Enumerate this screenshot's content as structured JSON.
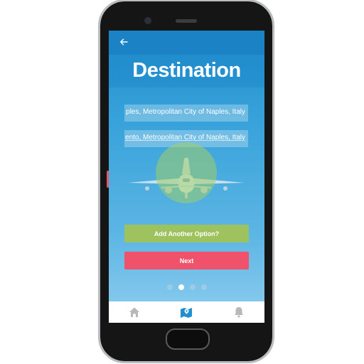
{
  "header": {
    "title": "Destination",
    "back_icon": "arrow-left-icon"
  },
  "destinations": [
    {
      "value": "Naples, Metropolitan City of Naples, Italy",
      "visible_text": "ples, Metropolitan City of Naples, Italy"
    },
    {
      "value": "Sorrento, Metropolitan City of Naples, Italy",
      "visible_text": "ento, Metropolitan City of Naples, Italy"
    }
  ],
  "buttons": {
    "add_option": "Add Another Option?",
    "next": "Next"
  },
  "pager": {
    "total": 4,
    "active": 1
  },
  "bottom_nav": [
    {
      "icon": "home-icon",
      "active": false
    },
    {
      "icon": "map-icon",
      "active": true
    },
    {
      "icon": "bell-icon",
      "active": false
    }
  ],
  "colors": {
    "accent_blue": "#1b82c6",
    "add_button": "#9ec25d",
    "next_button": "#f0526b",
    "nav_active": "#1f8fcf",
    "nav_inactive": "#b8b8b8"
  }
}
